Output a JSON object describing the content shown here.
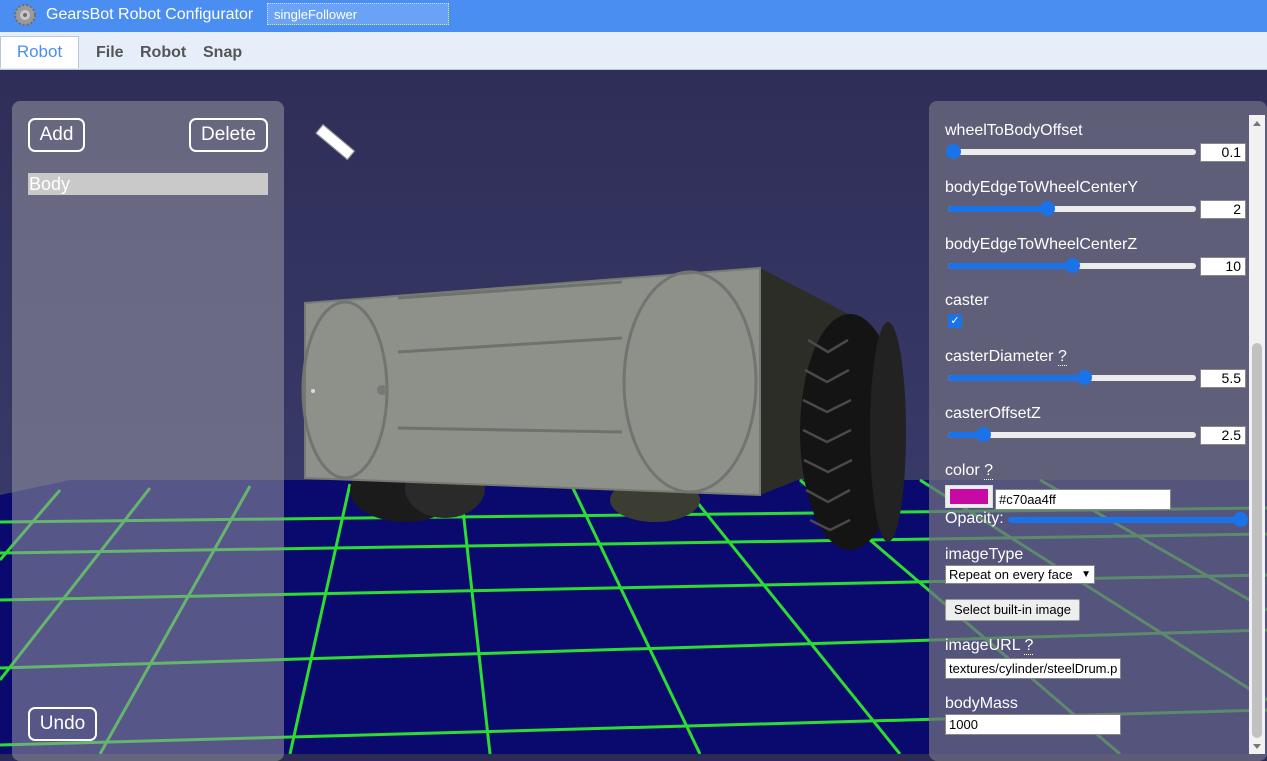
{
  "app": {
    "title": "GearsBot Robot Configurator",
    "robot_name": "singleFollower"
  },
  "tabs": {
    "active": "Robot"
  },
  "menu": [
    "File",
    "Robot",
    "Snap"
  ],
  "left_panel": {
    "add_label": "Add",
    "delete_label": "Delete",
    "components": [
      "Body"
    ],
    "undo_label": "Undo"
  },
  "properties": {
    "wheelToBodyOffset": {
      "label": "wheelToBodyOffset",
      "value": "0.1",
      "fraction": 0.02
    },
    "bodyEdgeToWheelCenterY": {
      "label": "bodyEdgeToWheelCenterY",
      "value": "2",
      "fraction": 0.4
    },
    "bodyEdgeToWheelCenterZ": {
      "label": "bodyEdgeToWheelCenterZ",
      "value": "10",
      "fraction": 0.5
    },
    "caster": {
      "label": "caster",
      "checked": true
    },
    "casterDiameter": {
      "label": "casterDiameter",
      "help": "?",
      "value": "5.5",
      "fraction": 0.55
    },
    "casterOffsetZ": {
      "label": "casterOffsetZ",
      "value": "2.5",
      "fraction": 0.14
    },
    "color": {
      "label": "color",
      "help": "?",
      "value": "#c70aa4ff",
      "swatch": "#c70aa4",
      "opacity_label": "Opacity:",
      "opacity": 1.0
    },
    "imageType": {
      "label": "imageType",
      "selected": "Repeat on every face"
    },
    "select_image_button": "Select built-in image",
    "imageURL": {
      "label": "imageURL",
      "help": "?",
      "value": "textures/cylinder/steelDrum.p"
    },
    "bodyMass": {
      "label": "bodyMass",
      "value": "1000"
    }
  }
}
